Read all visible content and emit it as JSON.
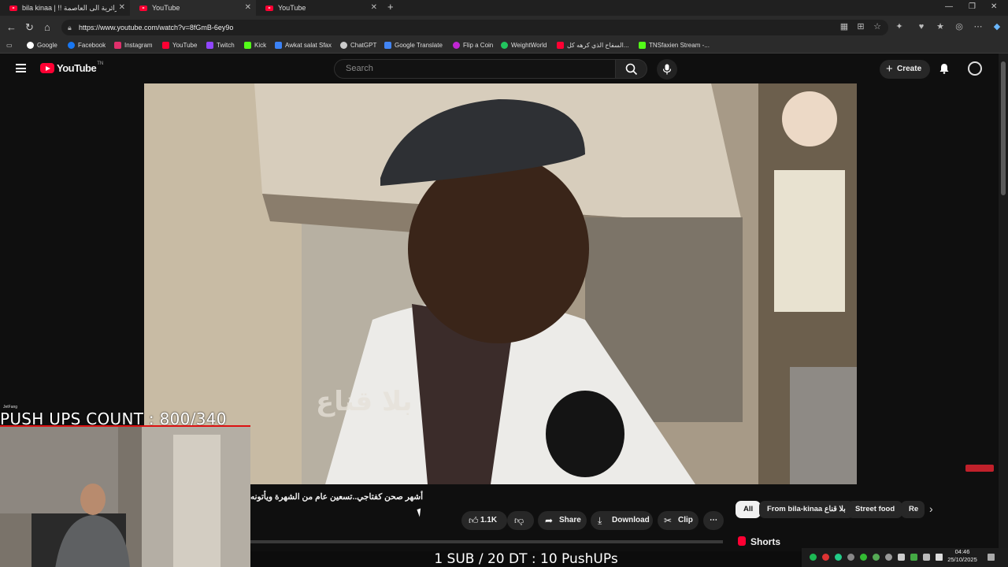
{
  "browser": {
    "tabs": [
      {
        "label": "bila kinaa | !! الجزائرية الى العاصمة"
      },
      {
        "label": "YouTube"
      },
      {
        "label": "YouTube"
      }
    ],
    "url": "https://www.youtube.com/watch?v=8fGmB-6ey9o",
    "bookmarks": [
      {
        "label": "Google",
        "color": "#ffffff"
      },
      {
        "label": "Facebook",
        "color": "#1877f2"
      },
      {
        "label": "Instagram",
        "color": "#e1306c"
      },
      {
        "label": "YouTube",
        "color": "#ff0033"
      },
      {
        "label": "Twitch",
        "color": "#9146ff"
      },
      {
        "label": "Kick",
        "color": "#53fc18"
      },
      {
        "label": "Awkat salat Sfax",
        "color": "#3b82f6"
      },
      {
        "label": "ChatGPT",
        "color": "#cccccc"
      },
      {
        "label": "Google Translate",
        "color": "#4285f4"
      },
      {
        "label": "Flip a Coin",
        "color": "#c026d3"
      },
      {
        "label": "WeightWorld",
        "color": "#22c55e"
      },
      {
        "label": "السفاح الذي كرهه كل...",
        "color": "#ff0033"
      },
      {
        "label": "TNSfaxien Stream -...",
        "color": "#53fc18"
      }
    ]
  },
  "youtube": {
    "logo_text": "YouTube",
    "logo_suffix": "TN",
    "search_placeholder": "Search",
    "create_label": "Create",
    "video_title": "أشهر صحن كفتاجي..تسعين عام من الشهرة ويأتونه",
    "video_watermark": "بلا قناع",
    "like_count": "1.1K",
    "share_label": "Share",
    "download_label": "Download",
    "clip_label": "Clip",
    "chips": [
      "All",
      "From bila-kinaa بلا قناع",
      "Street food",
      "Re"
    ],
    "shorts_label": "Shorts"
  },
  "stream_overlay": {
    "push_ups": "PUSH UPS COUNT : 800/340",
    "sub_rule": "1 SUB / 20 DT : 10 PushUPs",
    "cam_tag": "JetFang"
  },
  "taskbar": {
    "time": "04:46",
    "date": "25/10/2025"
  },
  "colors": {
    "accent": "#ff0033",
    "background": "#0f0f0f",
    "chip_bg": "#272727"
  }
}
